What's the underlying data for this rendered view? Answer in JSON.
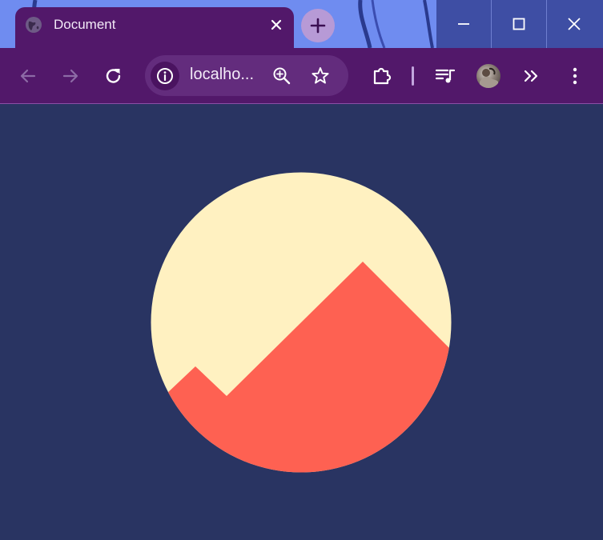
{
  "browser": {
    "tab": {
      "title": "Document",
      "favicon": "globe-icon",
      "close_icon": "close-icon"
    },
    "new_tab_icon": "plus-icon",
    "window_controls": [
      "minimize-icon",
      "maximize-icon",
      "close-icon"
    ],
    "toolbar": {
      "back_icon": "arrow-left-icon",
      "forward_icon": "arrow-right-icon",
      "reload_icon": "reload-icon",
      "url": "localho...",
      "site_info_icon": "info-icon",
      "zoom_icon": "zoom-in-icon",
      "bookmark_icon": "star-icon",
      "extensions_icon": "puzzle-icon",
      "media_icon": "media-control-icon",
      "profile_icon": "avatar",
      "overflow_icon": "chevron-double-right-icon",
      "menu_icon": "kebab-menu-icon"
    }
  },
  "page": {
    "background_color": "#293462",
    "illustration": {
      "sun_color": "#FFF1C1",
      "mountain_color": "#FE6152"
    }
  },
  "theme": {
    "frame_color": "#6F8CF0",
    "tab_color": "#52186A",
    "window_button_color": "#3E4EA4"
  }
}
